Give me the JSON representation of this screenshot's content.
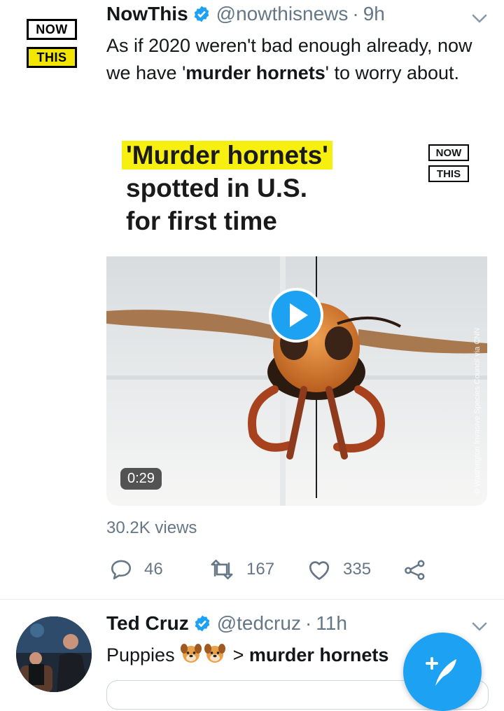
{
  "tweets": [
    {
      "avatar": {
        "line1": "NOW",
        "line2": "THIS"
      },
      "name": "NowThis",
      "handle": "@nowthisnews",
      "time": "9h",
      "text_parts": [
        "As if 2020 weren't bad enough already, now we have '",
        "murder hornets",
        "' to worry about."
      ],
      "media": {
        "headline_highlight": "'Murder hornets'",
        "headline_line2": "spotted in U.S.",
        "headline_line3": "for first time",
        "logo_line1": "NOW",
        "logo_line2": "THIS",
        "duration": "0:29",
        "credit": "© Washington Invasive Species Council via CNN"
      },
      "views": "30.2K views",
      "actions": {
        "replies": "46",
        "retweets": "167",
        "likes": "335"
      }
    },
    {
      "name": "Ted Cruz",
      "handle": "@tedcruz",
      "time": "11h",
      "text_prefix": "Puppies",
      "text_gt": " > ",
      "text_bold": "murder hornets"
    }
  ],
  "colors": {
    "accent": "#1da1f2",
    "muted": "#657786",
    "highlight": "#f6ef10"
  },
  "icons": [
    "verified-badge-icon",
    "chevron-down-icon",
    "play-icon",
    "reply-icon",
    "retweet-icon",
    "like-icon",
    "share-icon",
    "compose-tweet-icon",
    "dog-face-emoji"
  ]
}
